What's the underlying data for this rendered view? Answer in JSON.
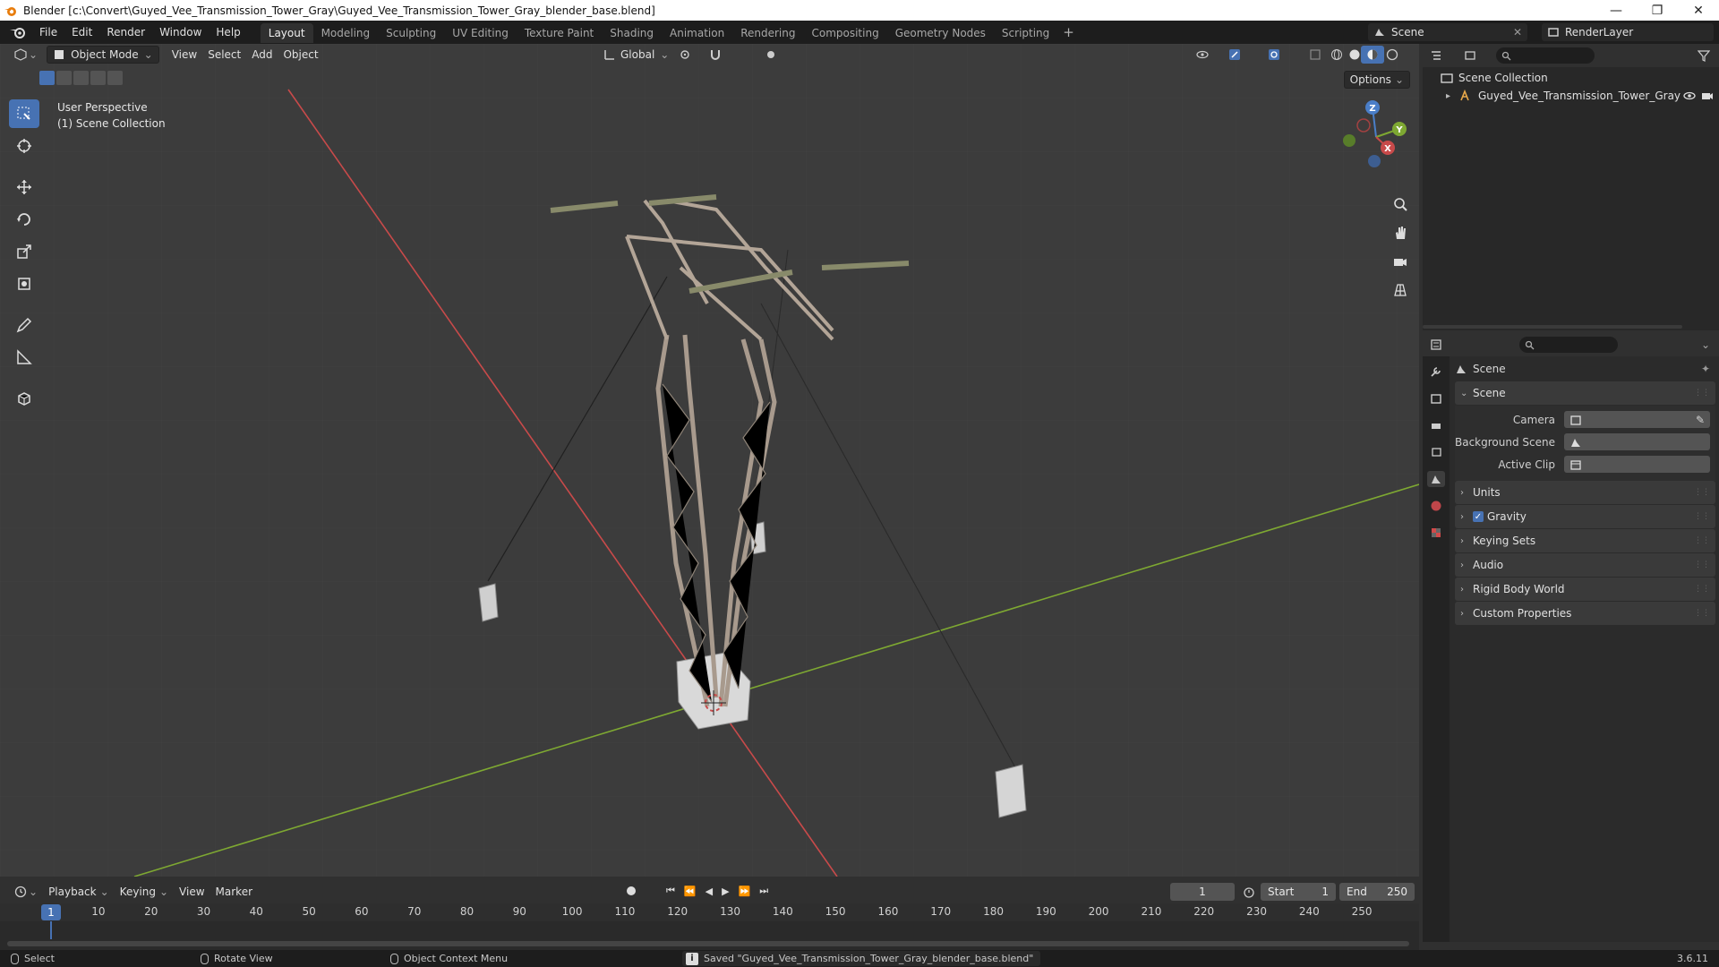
{
  "window": {
    "title": "Blender [c:\\Convert\\Guyed_Vee_Transmission_Tower_Gray\\Guyed_Vee_Transmission_Tower_Gray_blender_base.blend]",
    "controls": [
      "minimize",
      "maximize",
      "close"
    ]
  },
  "menubar": {
    "items": [
      "File",
      "Edit",
      "Render",
      "Window",
      "Help"
    ]
  },
  "workspaces": {
    "tabs": [
      "Layout",
      "Modeling",
      "Sculpting",
      "UV Editing",
      "Texture Paint",
      "Shading",
      "Animation",
      "Rendering",
      "Compositing",
      "Geometry Nodes",
      "Scripting"
    ],
    "active": "Layout",
    "add_label": "+"
  },
  "scene_selector": {
    "scene": "Scene",
    "view_layer": "RenderLayer"
  },
  "viewport": {
    "mode": "Object Mode",
    "menus": [
      "View",
      "Select",
      "Add",
      "Object"
    ],
    "orientation": "Global",
    "options_label": "Options",
    "overlay_line1": "User Perspective",
    "overlay_line2": "(1) Scene Collection",
    "gizmo_axes": {
      "z": "Z",
      "y": "Y",
      "x": "X"
    },
    "colors": {
      "x_axis": "#c84a4a",
      "y_axis": "#7ea832",
      "accent": "#4772b3"
    }
  },
  "outliner": {
    "root": "Scene Collection",
    "items": [
      {
        "name": "Guyed_Vee_Transmission_Tower_Gray"
      }
    ]
  },
  "properties": {
    "context_title": "Scene",
    "panel_scene": "Scene",
    "fields": [
      {
        "label": "Camera",
        "value": ""
      },
      {
        "label": "Background Scene",
        "value": ""
      },
      {
        "label": "Active Clip",
        "value": ""
      }
    ],
    "panels": [
      "Units",
      "Gravity",
      "Keying Sets",
      "Audio",
      "Rigid Body World",
      "Custom Properties"
    ],
    "gravity_checked": true
  },
  "timeline": {
    "menus": [
      "Playback",
      "Keying",
      "View",
      "Marker"
    ],
    "current_frame": "1",
    "start_label": "Start",
    "start_value": "1",
    "end_label": "End",
    "end_value": "250",
    "ticks": [
      "10",
      "20",
      "30",
      "40",
      "50",
      "60",
      "70",
      "80",
      "90",
      "100",
      "110",
      "120",
      "130",
      "140",
      "150",
      "160",
      "170",
      "180",
      "190",
      "200",
      "210",
      "220",
      "230",
      "240",
      "250"
    ],
    "current_marker": "1"
  },
  "statusbar": {
    "select": "Select",
    "rotate": "Rotate View",
    "context_menu": "Object Context Menu",
    "message": "Saved \"Guyed_Vee_Transmission_Tower_Gray_blender_base.blend\"",
    "version": "3.6.11"
  }
}
